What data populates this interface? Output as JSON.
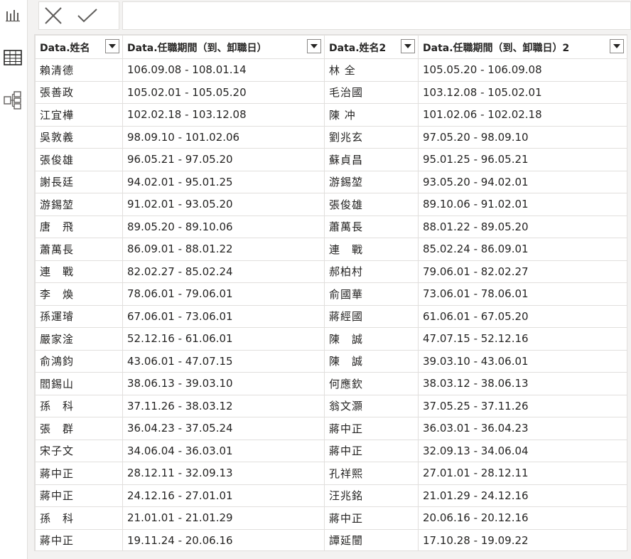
{
  "sidebar": {
    "items": [
      {
        "icon": "bar-chart-icon",
        "label": "Report"
      },
      {
        "icon": "table-icon",
        "label": "Data"
      },
      {
        "icon": "model-icon",
        "label": "Model"
      }
    ]
  },
  "formula_bar": {
    "cancel_icon": "close-icon",
    "commit_icon": "check-icon",
    "text": ""
  },
  "table": {
    "columns": [
      "Data.姓名",
      "Data.任職期間（到、卸職日）",
      "Data.姓名2",
      "Data.任職期間（到、卸職日）2"
    ],
    "rows": [
      [
        "賴清德",
        "106.09.08 - 108.01.14",
        "林 全",
        "105.05.20 - 106.09.08"
      ],
      [
        "張善政",
        "105.02.01 - 105.05.20",
        "毛治國",
        "103.12.08 - 105.02.01"
      ],
      [
        "江宜樺",
        "102.02.18 - 103.12.08",
        "陳 冲",
        "101.02.06 - 102.02.18"
      ],
      [
        "吳敦義",
        "98.09.10 - 101.02.06",
        "劉兆玄",
        "97.05.20 - 98.09.10"
      ],
      [
        "張俊雄",
        "96.05.21 - 97.05.20",
        "蘇貞昌",
        "95.01.25 - 96.05.21"
      ],
      [
        "謝長廷",
        "94.02.01 - 95.01.25",
        "游錫堃",
        "93.05.20 - 94.02.01"
      ],
      [
        "游錫堃",
        "91.02.01 - 93.05.20",
        "張俊雄",
        "89.10.06 - 91.02.01"
      ],
      [
        "唐　飛",
        "89.05.20 - 89.10.06",
        "蕭萬長",
        "88.01.22 - 89.05.20"
      ],
      [
        "蕭萬長",
        "86.09.01 - 88.01.22",
        "連　戰",
        "85.02.24 - 86.09.01"
      ],
      [
        "連　戰",
        "82.02.27 - 85.02.24",
        "郝柏村",
        "79.06.01 - 82.02.27"
      ],
      [
        "李　煥",
        "78.06.01 - 79.06.01",
        "俞國華",
        "73.06.01 - 78.06.01"
      ],
      [
        "孫運璿",
        "67.06.01 - 73.06.01",
        "蔣經國",
        "61.06.01 - 67.05.20"
      ],
      [
        "嚴家淦",
        "52.12.16 - 61.06.01",
        "陳　誠",
        "47.07.15 - 52.12.16"
      ],
      [
        "俞鴻鈞",
        "43.06.01 - 47.07.15",
        "陳　誠",
        "39.03.10 - 43.06.01"
      ],
      [
        "閻錫山",
        "38.06.13 - 39.03.10",
        "何應欽",
        "38.03.12 - 38.06.13"
      ],
      [
        "孫　科",
        "37.11.26 - 38.03.12",
        "翁文灝",
        "37.05.25 - 37.11.26"
      ],
      [
        "張　群",
        "36.04.23 - 37.05.24",
        "蔣中正",
        "36.03.01 - 36.04.23"
      ],
      [
        "宋子文",
        "34.06.04 - 36.03.01",
        "蔣中正",
        "32.09.13 - 34.06.04"
      ],
      [
        "蔣中正",
        "28.12.11 - 32.09.13",
        "孔祥熙",
        "27.01.01 - 28.12.11"
      ],
      [
        "蔣中正",
        "24.12.16 - 27.01.01",
        "汪兆銘",
        "21.01.29 - 24.12.16"
      ],
      [
        "孫　科",
        "21.01.01 - 21.01.29",
        "蔣中正",
        "20.06.16 - 20.12.16"
      ],
      [
        "蔣中正",
        "19.11.24 - 20.06.16",
        "譚延闓",
        "17.10.28 - 19.09.22"
      ]
    ]
  }
}
